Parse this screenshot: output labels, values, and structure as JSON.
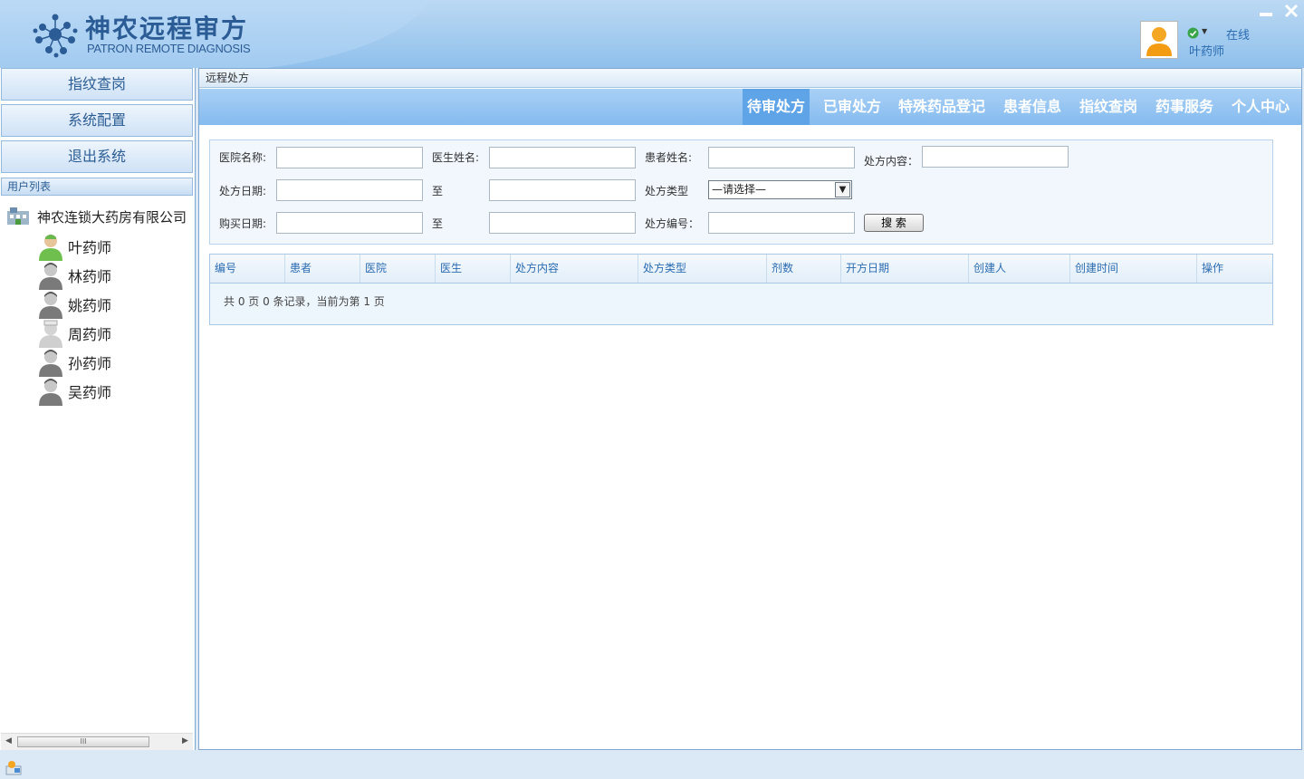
{
  "header": {
    "title": "神农远程审方",
    "subtitle": "PATRON REMOTE DIAGNOSIS",
    "status_text": "在线",
    "user_name": "叶药师"
  },
  "sidebar": {
    "nav": [
      "指纹查岗",
      "系统配置",
      "退出系统"
    ],
    "list_title": "用户列表",
    "root_label": "神农连锁大药房有限公司",
    "pharmacists": [
      {
        "name": "叶药师",
        "online": true,
        "icon": "pharmacist-online-icon"
      },
      {
        "name": "林药师",
        "online": false,
        "icon": "pharmacist-offline-icon"
      },
      {
        "name": "姚药师",
        "online": false,
        "icon": "pharmacist-offline-icon"
      },
      {
        "name": "周药师",
        "online": false,
        "icon": "nurse-offline-icon"
      },
      {
        "name": "孙药师",
        "online": false,
        "icon": "pharmacist-offline-icon"
      },
      {
        "name": "吴药师",
        "online": false,
        "icon": "pharmacist-offline-icon"
      }
    ],
    "scroll_thumb": "III"
  },
  "main": {
    "breadcrumb": "远程处方",
    "tabs": [
      "待审处方",
      "已审处方",
      "特殊药品登记",
      "患者信息",
      "指纹查岗",
      "药事服务",
      "个人中心"
    ],
    "active_tab": "待审处方",
    "search": {
      "hospital_label": "医院名称:",
      "doctor_label": "医生姓名:",
      "patient_label": "患者姓名:",
      "content_label": "处方内容：",
      "rx_date_label": "处方日期:",
      "to1": "至",
      "rx_type_label": "处方类型",
      "rx_type_value": "—请选择—",
      "buy_date_label": "购买日期:",
      "to2": "至",
      "rx_no_label": "处方编号：",
      "search_button": "搜  索"
    },
    "table": {
      "columns": [
        "编号",
        "患者",
        "医院",
        "医生",
        "处方内容",
        "处方类型",
        "剂数",
        "开方日期",
        "创建人",
        "创建时间",
        "操作"
      ],
      "rows": [],
      "pager": "共 0 页 0 条记录，当前为第 1 页"
    }
  },
  "colors": {
    "accent": "#2b6cb0",
    "tab_bar": "#85bbef",
    "active_tab": "#5ea4e7"
  }
}
